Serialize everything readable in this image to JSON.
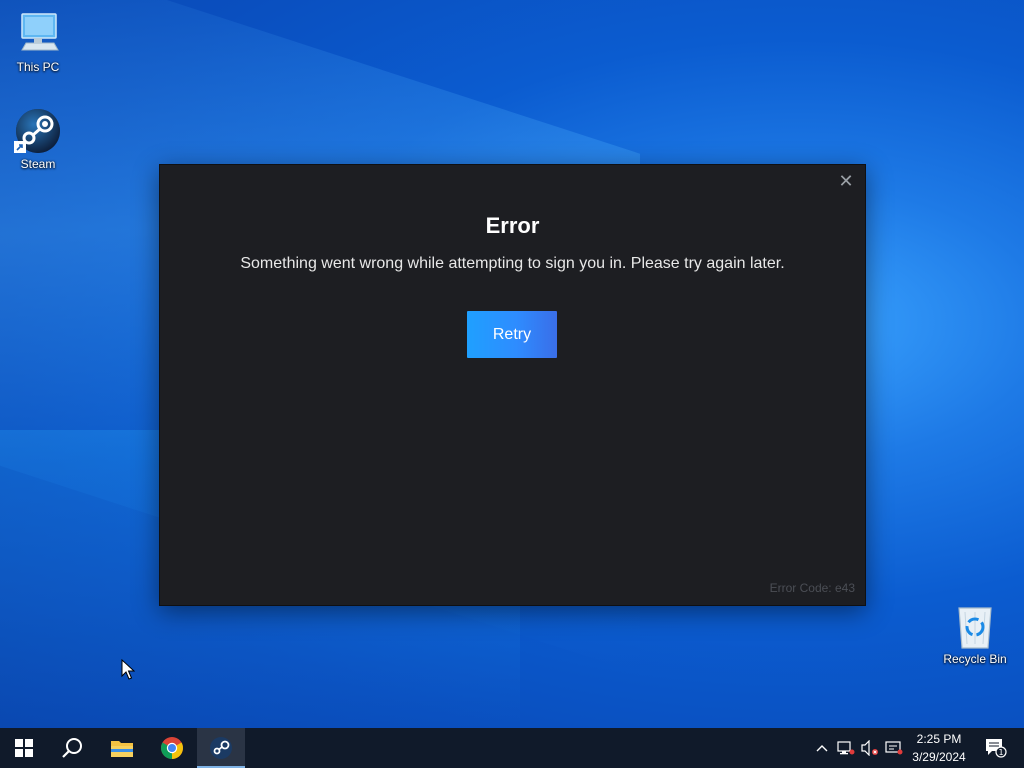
{
  "desktop": {
    "icons": [
      {
        "label": "This PC"
      },
      {
        "label": "Steam"
      },
      {
        "label": "Recycle Bin"
      }
    ]
  },
  "dialog": {
    "title": "Error",
    "message": "Something went wrong while attempting to sign you in. Please try again later.",
    "retry_label": "Retry",
    "close_glyph": "✕",
    "error_code": "Error Code: e43"
  },
  "taskbar": {
    "buttons": [
      "windows-start-icon",
      "search-icon",
      "file-explorer-icon",
      "chrome-icon",
      "steam-icon"
    ],
    "active": "steam-icon",
    "tray": {
      "chevron": "^",
      "icons": [
        "network-icon",
        "volume-muted-icon",
        "message-icon"
      ],
      "time": "2:25 PM",
      "date": "3/29/2024",
      "notification_count": "1"
    }
  },
  "colors": {
    "dialog_bg": "#1d1e22",
    "accent": "#1fa0ff",
    "taskbar": "#101a2a"
  }
}
